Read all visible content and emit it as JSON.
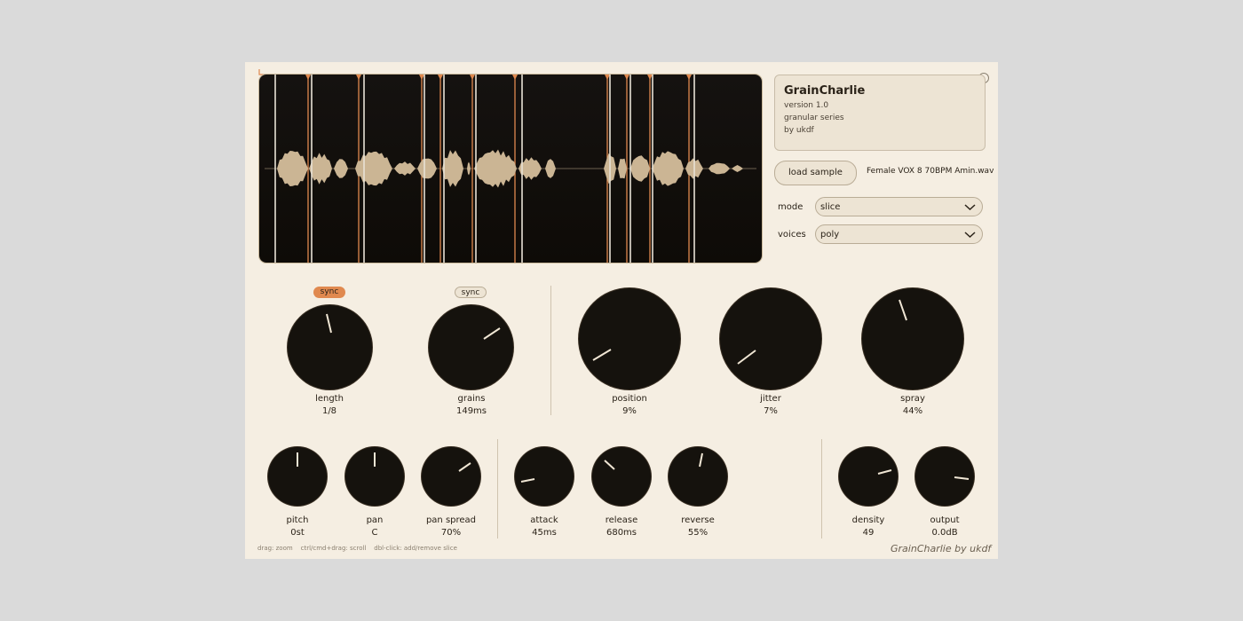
{
  "app": {
    "name": "GrainCharlie",
    "version": "version 1.0",
    "series": "granular series",
    "author": "by ukdf",
    "footer": "GrainCharlie by ukdf",
    "hint": "drag: zoom    ctrl/cmd+drag: scroll    dbl-click: add/remove slice"
  },
  "colors": {
    "accent": "#e0894f",
    "background": "#f5eee2",
    "panel": "#ede4d4",
    "knob": "#15120d",
    "waveform": "#cbb594"
  },
  "sample": {
    "load_label": "load sample",
    "filename": "Female VOX 8 70BPM Amin.wav"
  },
  "mode": {
    "label": "mode",
    "value": "slice"
  },
  "voices": {
    "label": "voices",
    "value": "poly"
  },
  "length": {
    "label": "length",
    "value": "1/8",
    "sync_label": "sync",
    "sync_on": true
  },
  "grains": {
    "label": "grains",
    "value": "149ms",
    "sync_label": "sync",
    "sync_on": false
  },
  "position": {
    "label": "position",
    "value": "9%"
  },
  "jitter": {
    "label": "jitter",
    "value": "7%"
  },
  "spray": {
    "label": "spray",
    "value": "44%"
  },
  "pitch": {
    "label": "pitch",
    "value": "0st"
  },
  "pan": {
    "label": "pan",
    "value": "C"
  },
  "pan_spread": {
    "label": "pan spread",
    "value": "70%"
  },
  "attack": {
    "label": "attack",
    "value": "45ms"
  },
  "release": {
    "label": "release",
    "value": "680ms"
  },
  "reverse": {
    "label": "reverse",
    "value": "55%"
  },
  "density": {
    "label": "density",
    "value": "49"
  },
  "output": {
    "label": "output",
    "value": "0.0dB"
  }
}
